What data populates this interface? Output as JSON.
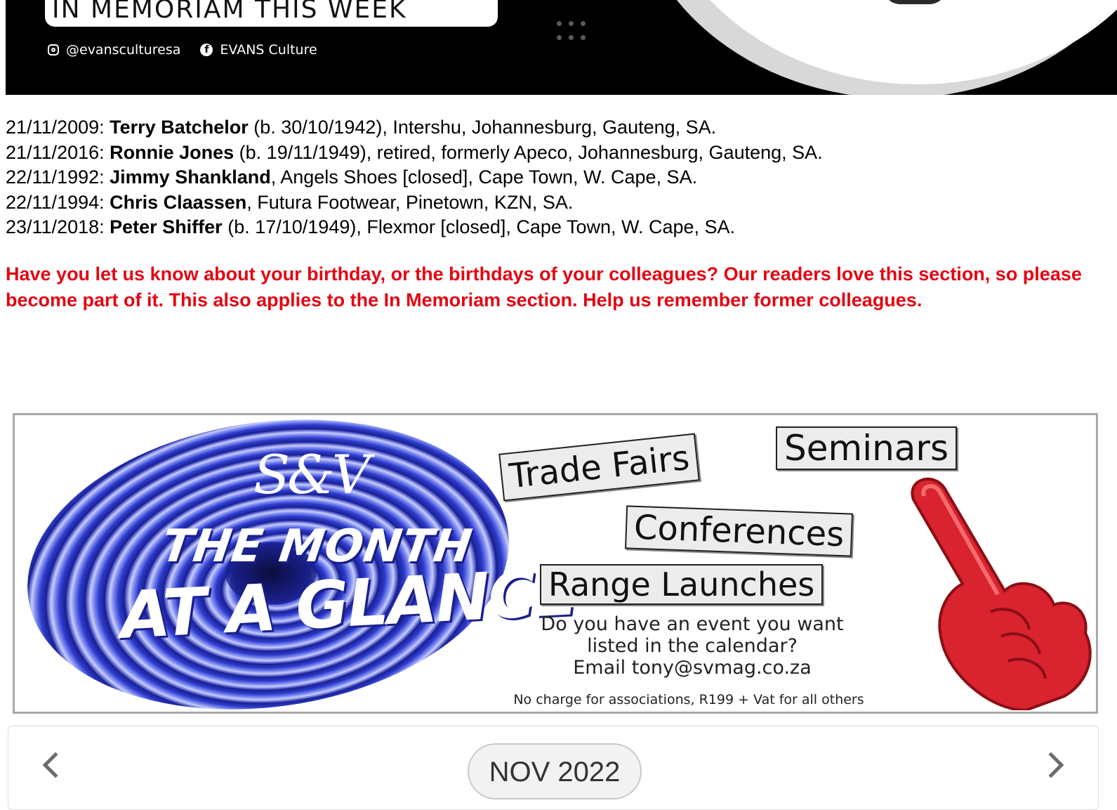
{
  "banner": {
    "title": "IN MEMORIAM THIS WEEK",
    "instagram": "@evansculturesa",
    "facebook": "EVANS Culture",
    "bg_color": "#000000"
  },
  "memoriam": [
    {
      "date": "21/11/2009: ",
      "name": "Terry Batchelor",
      "details": " (b. 30/10/1942), Intershu, Johannesburg, Gauteng, SA."
    },
    {
      "date": "21/11/2016: ",
      "name": "Ronnie Jones",
      "details": " (b. 19/11/1949), retired, formerly Apeco, Johannesburg, Gauteng, SA."
    },
    {
      "date": "22/11/1992: ",
      "name": "Jimmy Shankland",
      "details": ", Angels Shoes [closed], Cape Town, W. Cape, SA."
    },
    {
      "date": "22/11/1994: ",
      "name": "Chris Claassen",
      "details": ", Futura Footwear, Pinetown, KZN, SA."
    },
    {
      "date": "23/11/2018: ",
      "name": "Peter Shiffer",
      "details": " (b. 17/10/1949), Flexmor [closed], Cape Town, W. Cape, SA."
    }
  ],
  "notice": {
    "text": "Have you let us know about your birthday, or the birthdays of your colleagues? Our readers love this section, so please become part of it. This also applies to the In Memoriam section. Help us remember former colleagues.",
    "color": "#e30613"
  },
  "ad": {
    "logo": "S&V",
    "headline_1": "THE MONTH",
    "headline_2": "AT A GLANCE",
    "tag_trade": "Trade Fairs",
    "tag_seminars": "Seminars",
    "tag_conferences": "Conferences",
    "tag_range": "Range Launches",
    "ask_line_1": "Do you have an event you want",
    "ask_line_2": "listed in the calendar?",
    "ask_line_3": "Email tony@svmag.co.za",
    "fee": "No charge for associations, R199 + Vat for all others",
    "hand_color": "#d9232e"
  },
  "calendar": {
    "month_label": "NOV 2022",
    "prev_icon": "chevron-left-icon",
    "next_icon": "chevron-right-icon"
  }
}
